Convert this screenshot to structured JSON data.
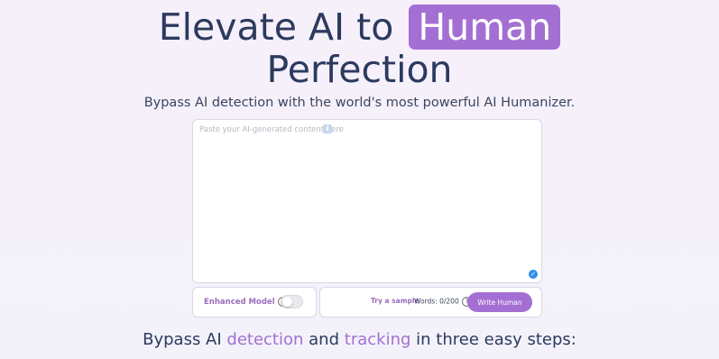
{
  "hero": {
    "line1_prefix": "Elevate AI to",
    "highlight": "Human",
    "line2": "Perfection",
    "subtitle": "Bypass AI detection with the world's most powerful AI Humanizer."
  },
  "editor": {
    "placeholder": "Paste your AI-generated content here",
    "value": "",
    "info_icon": "info-icon",
    "status_icon": "check-circle-icon"
  },
  "controls": {
    "enhanced_model_label": "Enhanced Model",
    "help_glyph": "?",
    "enhanced_model_enabled": false,
    "try_sample_label": "Try a sample",
    "words_label": "Words: 0/200",
    "write_button_label": "Write Human"
  },
  "steps": {
    "prefix": "Bypass AI",
    "word1": "detection",
    "middle": "and",
    "word2": "tracking",
    "suffix": "in three easy steps:"
  },
  "colors": {
    "accent": "#a46fd2",
    "heading": "#2c3a5e",
    "status_blue": "#2f8fe8"
  }
}
